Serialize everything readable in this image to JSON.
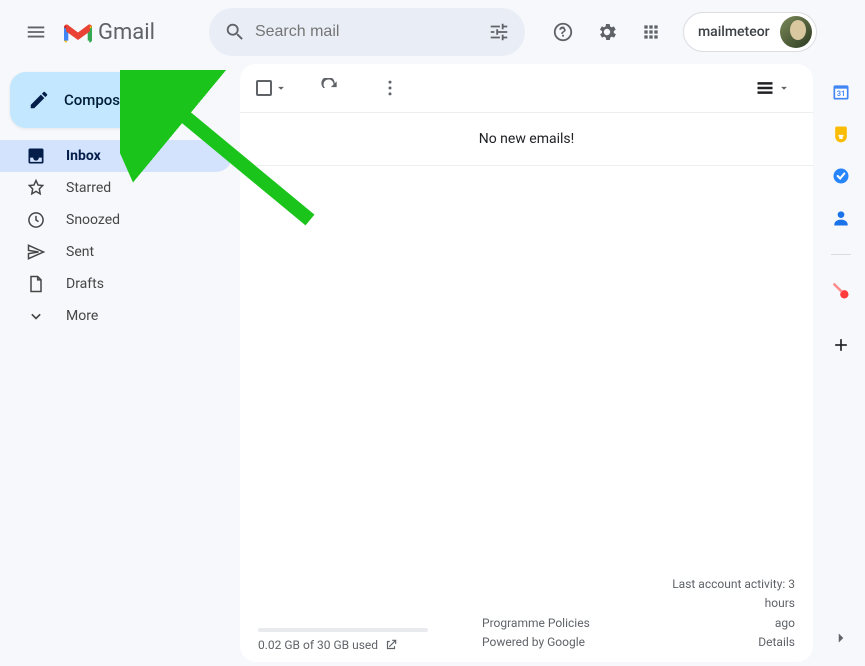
{
  "header": {
    "product_name": "Gmail",
    "search_placeholder": "Search mail",
    "account_name": "mailmeteor"
  },
  "sidebar": {
    "compose_label": "Compose",
    "items": [
      {
        "label": "Inbox"
      },
      {
        "label": "Starred"
      },
      {
        "label": "Snoozed"
      },
      {
        "label": "Sent"
      },
      {
        "label": "Drafts"
      },
      {
        "label": "More"
      }
    ]
  },
  "main": {
    "empty_message": "No new emails!",
    "storage_text": "0.02 GB of 30 GB used",
    "policies_line1": "Programme Policies",
    "policies_line2": "Powered by Google",
    "activity_line1": "Last account activity: 3 hours",
    "activity_line2": "ago",
    "activity_details": "Details"
  }
}
